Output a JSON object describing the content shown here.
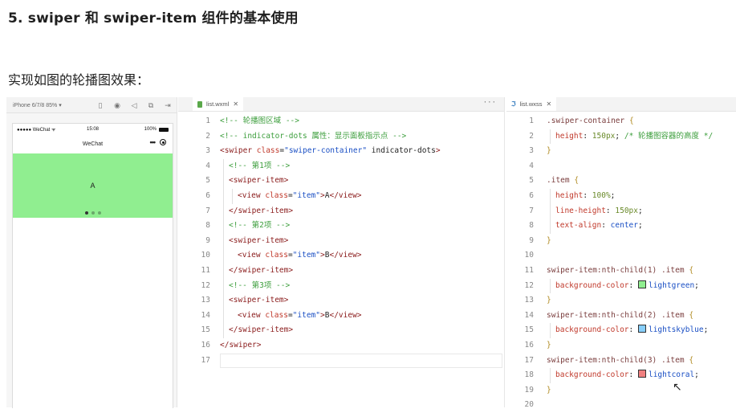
{
  "heading": "5. swiper 和 swiper-item 组件的基本使用",
  "subtitle": "实现如图的轮播图效果：",
  "simulator": {
    "device": "iPhone 6/7/8 85% ▾",
    "tool_icons": [
      "phone-icon",
      "record-icon",
      "speaker-icon",
      "window-icon",
      "compile-icon"
    ],
    "status_left": "●●●●● WeChat ᯤ",
    "status_time": "15:08",
    "status_right": "100%",
    "nav_title": "WeChat",
    "nav_more": "•••",
    "swiper_text": "A",
    "swiper_color": "#90ee90",
    "dots": 3,
    "active_dot": 0
  },
  "editor_wxml": {
    "tab": "list.wxml",
    "tab_close": "✕",
    "more": "···",
    "lines": [
      {
        "n": "1",
        "parts": [
          [
            "cm",
            "<!-- 轮播图区域 -->"
          ]
        ]
      },
      {
        "n": "2",
        "parts": [
          [
            "cm",
            "<!-- indicator-dots 属性：显示面板指示点 -->"
          ]
        ]
      },
      {
        "n": "3",
        "parts": [
          [
            "tag",
            "<swiper "
          ],
          [
            "attr",
            "class"
          ],
          [
            "txt",
            "="
          ],
          [
            "str",
            "\"swiper-container\""
          ],
          [
            "txt",
            " indicator-dots"
          ],
          [
            "tag",
            ">"
          ]
        ]
      },
      {
        "n": "4",
        "indent": 1,
        "parts": [
          [
            "cm",
            "<!-- 第1项 -->"
          ]
        ]
      },
      {
        "n": "5",
        "indent": 1,
        "parts": [
          [
            "tag",
            "<swiper-item>"
          ]
        ]
      },
      {
        "n": "6",
        "indent": 2,
        "parts": [
          [
            "tag",
            "<view "
          ],
          [
            "attr",
            "class"
          ],
          [
            "txt",
            "="
          ],
          [
            "str",
            "\"item\""
          ],
          [
            "tag",
            ">"
          ],
          [
            "txt",
            "A"
          ],
          [
            "tag",
            "</view>"
          ]
        ]
      },
      {
        "n": "7",
        "indent": 1,
        "parts": [
          [
            "tag",
            "</swiper-item>"
          ]
        ]
      },
      {
        "n": "8",
        "indent": 1,
        "parts": [
          [
            "cm",
            "<!-- 第2项 -->"
          ]
        ]
      },
      {
        "n": "9",
        "indent": 1,
        "parts": [
          [
            "tag",
            "<swiper-item>"
          ]
        ]
      },
      {
        "n": "10",
        "indent": 2,
        "parts": [
          [
            "tag",
            "<view "
          ],
          [
            "attr",
            "class"
          ],
          [
            "txt",
            "="
          ],
          [
            "str",
            "\"item\""
          ],
          [
            "tag",
            ">"
          ],
          [
            "txt",
            "B"
          ],
          [
            "tag",
            "</view>"
          ]
        ]
      },
      {
        "n": "11",
        "indent": 1,
        "parts": [
          [
            "tag",
            "</swiper-item>"
          ]
        ]
      },
      {
        "n": "12",
        "indent": 1,
        "parts": [
          [
            "cm",
            "<!-- 第3项 -->"
          ]
        ]
      },
      {
        "n": "13",
        "indent": 1,
        "parts": [
          [
            "tag",
            "<swiper-item>"
          ]
        ]
      },
      {
        "n": "14",
        "indent": 2,
        "parts": [
          [
            "tag",
            "<view "
          ],
          [
            "attr",
            "class"
          ],
          [
            "txt",
            "="
          ],
          [
            "str",
            "\"item\""
          ],
          [
            "tag",
            ">"
          ],
          [
            "txt",
            "B"
          ],
          [
            "tag",
            "</view>"
          ]
        ]
      },
      {
        "n": "15",
        "indent": 1,
        "parts": [
          [
            "tag",
            "</swiper-item>"
          ]
        ]
      },
      {
        "n": "16",
        "parts": [
          [
            "tag",
            "</swiper>"
          ]
        ]
      },
      {
        "n": "17",
        "parts": []
      }
    ]
  },
  "editor_wxss": {
    "tab": "list.wxss",
    "tab_close": "✕",
    "lines": [
      {
        "n": "1",
        "parts": [
          [
            "sel",
            ".swiper-container "
          ],
          [
            "brace",
            "{"
          ]
        ]
      },
      {
        "n": "2",
        "indent": 1,
        "parts": [
          [
            "prop",
            "height"
          ],
          [
            "txt",
            ": "
          ],
          [
            "num",
            "150px"
          ],
          [
            "txt",
            "; "
          ],
          [
            "cm",
            "/* 轮播图容器的高度 */"
          ]
        ]
      },
      {
        "n": "3",
        "parts": [
          [
            "brace",
            "}"
          ]
        ]
      },
      {
        "n": "4",
        "parts": []
      },
      {
        "n": "5",
        "parts": [
          [
            "sel",
            ".item "
          ],
          [
            "brace",
            "{"
          ]
        ]
      },
      {
        "n": "6",
        "indent": 1,
        "parts": [
          [
            "prop",
            "height"
          ],
          [
            "txt",
            ": "
          ],
          [
            "num",
            "100%"
          ],
          [
            "txt",
            ";"
          ]
        ]
      },
      {
        "n": "7",
        "indent": 1,
        "parts": [
          [
            "prop",
            "line-height"
          ],
          [
            "txt",
            ": "
          ],
          [
            "num",
            "150px"
          ],
          [
            "txt",
            ";"
          ]
        ]
      },
      {
        "n": "8",
        "indent": 1,
        "parts": [
          [
            "prop",
            "text-align"
          ],
          [
            "txt",
            ": "
          ],
          [
            "val",
            "center"
          ],
          [
            "txt",
            ";"
          ]
        ]
      },
      {
        "n": "9",
        "parts": [
          [
            "brace",
            "}"
          ]
        ]
      },
      {
        "n": "10",
        "parts": []
      },
      {
        "n": "11",
        "parts": [
          [
            "sel",
            "swiper-item:nth-child(1) .item "
          ],
          [
            "brace",
            "{"
          ]
        ]
      },
      {
        "n": "12",
        "indent": 1,
        "parts": [
          [
            "prop",
            "background-color"
          ],
          [
            "txt",
            ": "
          ],
          [
            "swatch",
            "#90ee90"
          ],
          [
            "val",
            "lightgreen"
          ],
          [
            "txt",
            ";"
          ]
        ]
      },
      {
        "n": "13",
        "parts": [
          [
            "brace",
            "}"
          ]
        ]
      },
      {
        "n": "14",
        "parts": [
          [
            "sel",
            "swiper-item:nth-child(2) .item "
          ],
          [
            "brace",
            "{"
          ]
        ]
      },
      {
        "n": "15",
        "indent": 1,
        "parts": [
          [
            "prop",
            "background-color"
          ],
          [
            "txt",
            ": "
          ],
          [
            "swatch",
            "#87cefa"
          ],
          [
            "val",
            "lightskyblue"
          ],
          [
            "txt",
            ";"
          ]
        ]
      },
      {
        "n": "16",
        "parts": [
          [
            "brace",
            "}"
          ]
        ]
      },
      {
        "n": "17",
        "parts": [
          [
            "sel",
            "swiper-item:nth-child(3) .item "
          ],
          [
            "brace",
            "{"
          ]
        ]
      },
      {
        "n": "18",
        "indent": 1,
        "parts": [
          [
            "prop",
            "background-color"
          ],
          [
            "txt",
            ": "
          ],
          [
            "swatch",
            "#f08080"
          ],
          [
            "val",
            "lightcoral"
          ],
          [
            "txt",
            ";"
          ]
        ]
      },
      {
        "n": "19",
        "parts": [
          [
            "brace",
            "}"
          ]
        ]
      },
      {
        "n": "20",
        "parts": []
      }
    ]
  }
}
